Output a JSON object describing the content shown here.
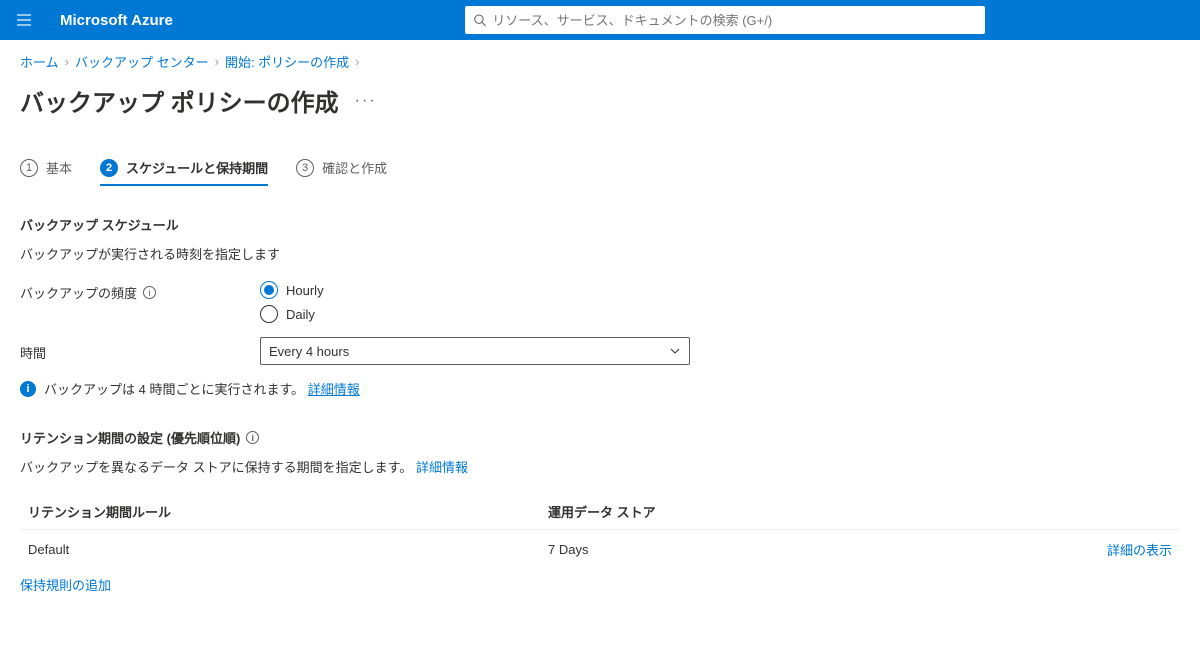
{
  "brand": "Microsoft Azure",
  "search": {
    "placeholder": "リソース、サービス、ドキュメントの検索 (G+/)"
  },
  "breadcrumbs": {
    "items": [
      "ホーム",
      "バックアップ センター",
      "開始: ポリシーの作成"
    ]
  },
  "page_title": "バックアップ ポリシーの作成",
  "tabs": {
    "items": [
      {
        "num": "1",
        "label": "基本"
      },
      {
        "num": "2",
        "label": "スケジュールと保持期間"
      },
      {
        "num": "3",
        "label": "確認と作成"
      }
    ],
    "active_index": 1
  },
  "schedule_section": {
    "title": "バックアップ スケジュール",
    "desc": "バックアップが実行される時刻を指定します",
    "frequency_label": "バックアップの頻度",
    "options": {
      "hourly": "Hourly",
      "daily": "Daily"
    },
    "selected": "hourly",
    "time_label": "時間",
    "time_value": "Every 4 hours",
    "info_text": "バックアップは 4 時間ごとに実行されます。",
    "info_link": "詳細情報"
  },
  "retention_section": {
    "title": "リテンション期間の設定 (優先順位順)",
    "desc_prefix": "バックアップを異なるデータ ストアに保持する期間を指定します。",
    "desc_link": "詳細情報",
    "columns": {
      "rule": "リテンション期間ルール",
      "store": "運用データ ストア"
    },
    "rows": [
      {
        "rule": "Default",
        "store": "7 Days",
        "action": "詳細の表示"
      }
    ],
    "add_rule": "保持規則の追加"
  }
}
